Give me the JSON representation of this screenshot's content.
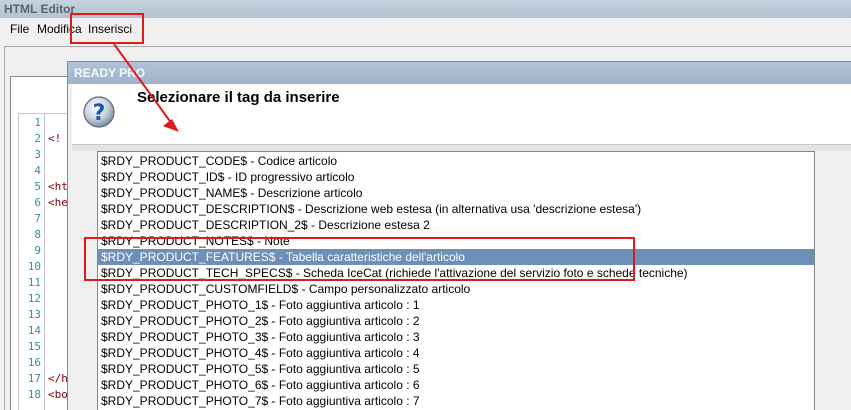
{
  "editor": {
    "title": "HTML Editor",
    "menu": [
      "File",
      "Modifica",
      "Inserisci"
    ],
    "line_numbers": [
      "1",
      "2",
      "3",
      "4",
      "5",
      "6",
      "7",
      "8",
      "9",
      "10",
      "11",
      "12",
      "13",
      "14",
      "15",
      "16",
      "17",
      "18"
    ],
    "code_lines": [
      {
        "line": 2,
        "text": "<!"
      },
      {
        "line": 5,
        "text": "<ht"
      },
      {
        "line": 6,
        "text": "<he"
      },
      {
        "line": 17,
        "text": "</h"
      },
      {
        "line": 18,
        "text": "<bo"
      }
    ]
  },
  "dialog": {
    "title": "READY PRO",
    "heading": "Selezionare il tag da inserire",
    "icon": "question-icon",
    "items": [
      "$RDY_PRODUCT_CODE$ - Codice articolo",
      "$RDY_PRODUCT_ID$ - ID progressivo articolo",
      "$RDY_PRODUCT_NAME$ - Descrizione articolo",
      "$RDY_PRODUCT_DESCRIPTION$ - Descrizione web estesa (in alternativa usa 'descrizione estesa')",
      "$RDY_PRODUCT_DESCRIPTION_2$ - Descrizione estesa 2",
      "$RDY_PRODUCT_NOTES$ - Note",
      "$RDY_PRODUCT_FEATURES$ - Tabella caratteristiche dell'articolo",
      "$RDY_PRODUCT_TECH_SPECS$ - Scheda IceCat (richiede l'attivazione del servizio foto e schede tecniche)",
      "$RDY_PRODUCT_CUSTOMFIELD$ - Campo personalizzato articolo",
      "$RDY_PRODUCT_PHOTO_1$ - Foto aggiuntiva articolo : 1",
      "$RDY_PRODUCT_PHOTO_2$ - Foto aggiuntiva articolo : 2",
      "$RDY_PRODUCT_PHOTO_3$ - Foto aggiuntiva articolo : 3",
      "$RDY_PRODUCT_PHOTO_4$ - Foto aggiuntiva articolo : 4",
      "$RDY_PRODUCT_PHOTO_5$ - Foto aggiuntiva articolo : 5",
      "$RDY_PRODUCT_PHOTO_6$ - Foto aggiuntiva articolo : 6",
      "$RDY_PRODUCT_PHOTO_7$ - Foto aggiuntiva articolo : 7"
    ],
    "selected_index": 6
  },
  "colors": {
    "selection": "#6e8fb8",
    "annotation": "#e01b1b",
    "line_number": "#2b91af",
    "code_text": "#800000"
  }
}
